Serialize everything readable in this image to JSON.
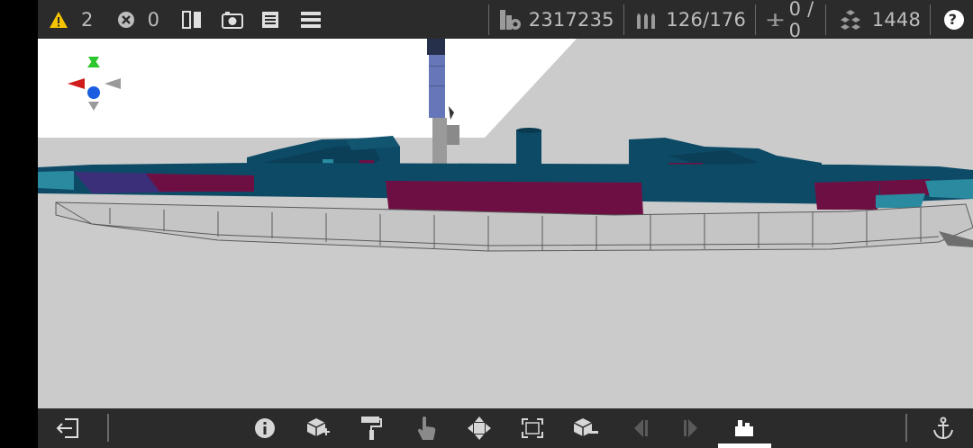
{
  "toolbar": {
    "warnings_count": "2",
    "errors_count": "0",
    "cost": "2317235",
    "ammo": "126/176",
    "aircraft": "0 / 0",
    "parts": "1448",
    "help_label": "?"
  },
  "icons": {
    "warning": "warning-triangle-icon",
    "error": "error-x-circle-icon",
    "mirror": "mirror-symmetry-icon",
    "camera": "camera-icon",
    "document": "document-icon",
    "menu": "menu-icon",
    "cost": "cost-coin-stack-icon",
    "ammo": "ammo-shells-icon",
    "aircraft": "aircraft-icon",
    "parts": "parts-stack-icon",
    "help": "help-icon",
    "exit": "exit-icon",
    "info": "info-icon",
    "add_part": "add-part-icon",
    "paint": "paint-roller-icon",
    "hand": "hand-pointer-icon",
    "move": "move-arrows-icon",
    "scale": "scale-frame-icon",
    "remove_part": "remove-part-icon",
    "prev": "previous-icon",
    "next": "next-icon",
    "category": "category-icon",
    "anchor": "anchor-icon"
  },
  "colors": {
    "bar": "#2b2b2b",
    "deck_blue": "#0d4a66",
    "camo_magenta": "#6e0f43",
    "hull_grey": "#c3c3c3",
    "warning_yellow": "#f5c400"
  }
}
